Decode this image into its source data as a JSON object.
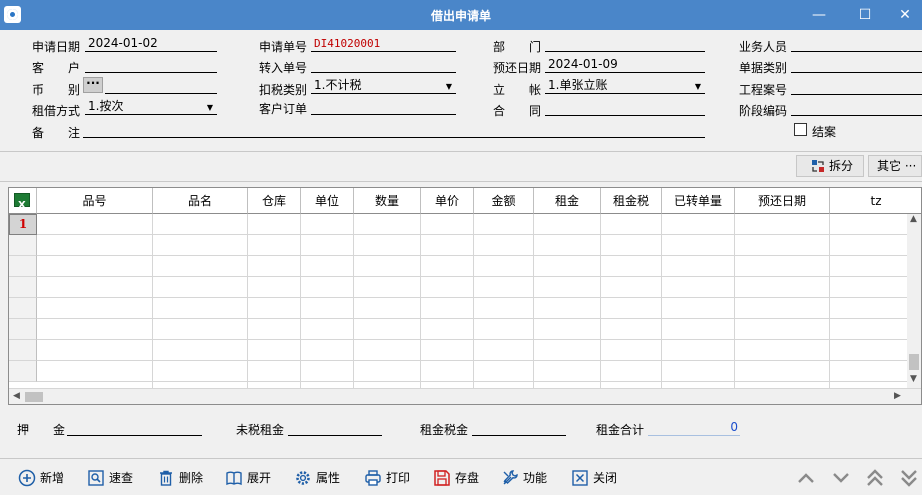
{
  "window": {
    "title": "借出申请单",
    "minimize": "—",
    "maximize": "☐",
    "close": "✕"
  },
  "form": {
    "apply_date_label": "申请日期",
    "apply_date": "2024-01-02",
    "apply_no_label": "申请单号",
    "apply_no": "DI41020001",
    "dept_label": "部　　门",
    "dept": "",
    "salesperson_label": "业务人员",
    "salesperson": "",
    "customer_label": "客　　户",
    "customer": "",
    "transfer_no_label": "转入单号",
    "transfer_no": "",
    "return_date_label": "预还日期",
    "return_date": "2024-01-09",
    "doc_type_label": "单据类别",
    "doc_type": "",
    "currency_label": "币　　别",
    "currency_btn": "···",
    "currency": "",
    "tax_type_label": "扣税类别",
    "tax_type": "1.不计税",
    "account_label": "立　　帐",
    "account": "1.单张立账",
    "project_label": "工程案号",
    "project": "",
    "rent_mode_label": "租借方式",
    "rent_mode": "1.按次",
    "cust_order_label": "客户订单",
    "cust_order": "",
    "contract_label": "合　　同",
    "contract": "",
    "stage_code_label": "阶段编码",
    "stage_code": "",
    "closed_label": "结案",
    "remark_label": "备　　注",
    "remark": ""
  },
  "actions": {
    "split": "拆分",
    "other": "其它 ···"
  },
  "grid": {
    "columns": [
      "品号",
      "品名",
      "仓库",
      "单位",
      "数量",
      "单价",
      "金额",
      "租金",
      "租金税",
      "已转单量",
      "预还日期",
      "tz"
    ],
    "first_row_no": "1"
  },
  "totals": {
    "deposit_label": "押　　金",
    "deposit": "",
    "untaxed_rent_label": "未税租金",
    "untaxed_rent": "",
    "rent_tax_label": "租金税金",
    "rent_tax": "",
    "rent_total_label": "租金合计",
    "rent_total": "0"
  },
  "toolbar": {
    "add": "新增",
    "query": "速查",
    "delete": "删除",
    "expand": "展开",
    "properties": "属性",
    "print": "打印",
    "save": "存盘",
    "function": "功能",
    "close": "关闭"
  }
}
